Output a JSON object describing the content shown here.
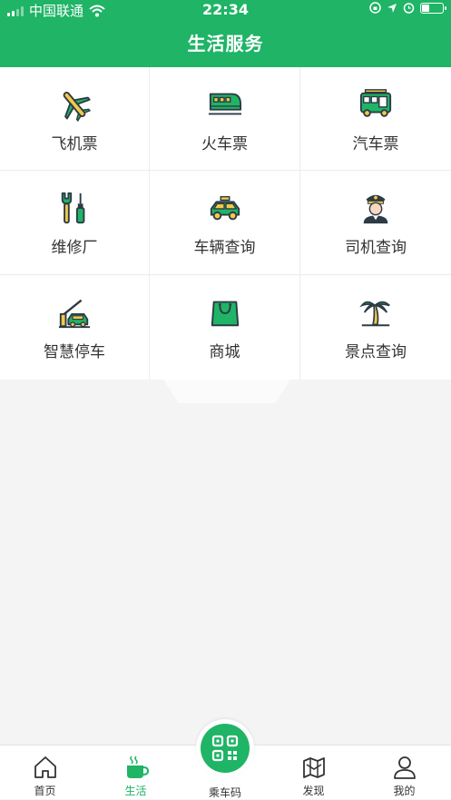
{
  "status_bar": {
    "carrier": "中国联通",
    "time": "22:34"
  },
  "header": {
    "title": "生活服务"
  },
  "services": [
    {
      "label": "飞机票",
      "icon": "airplane-icon"
    },
    {
      "label": "火车票",
      "icon": "train-icon"
    },
    {
      "label": "汽车票",
      "icon": "bus-icon"
    },
    {
      "label": "维修厂",
      "icon": "repair-tools-icon"
    },
    {
      "label": "车辆查询",
      "icon": "car-icon"
    },
    {
      "label": "司机查询",
      "icon": "driver-icon"
    },
    {
      "label": "智慧停车",
      "icon": "parking-gate-icon"
    },
    {
      "label": "商城",
      "icon": "shopping-bag-icon"
    },
    {
      "label": "景点查询",
      "icon": "palm-tree-icon"
    }
  ],
  "tabbar": {
    "home": "首页",
    "life": "生活",
    "ride_code": "乘车码",
    "discover": "发现",
    "mine": "我的"
  },
  "colors": {
    "brand": "#1fb466",
    "icon_yellow": "#f3c948",
    "icon_dark": "#2d3b45"
  }
}
